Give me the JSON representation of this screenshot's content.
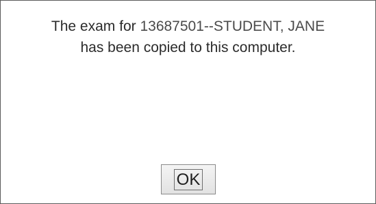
{
  "dialog": {
    "message_line1_prefix": "The exam for ",
    "message_line1_student": "13687501--STUDENT, JANE",
    "message_line2": "has been copied to this computer.",
    "ok_label": "OK"
  }
}
